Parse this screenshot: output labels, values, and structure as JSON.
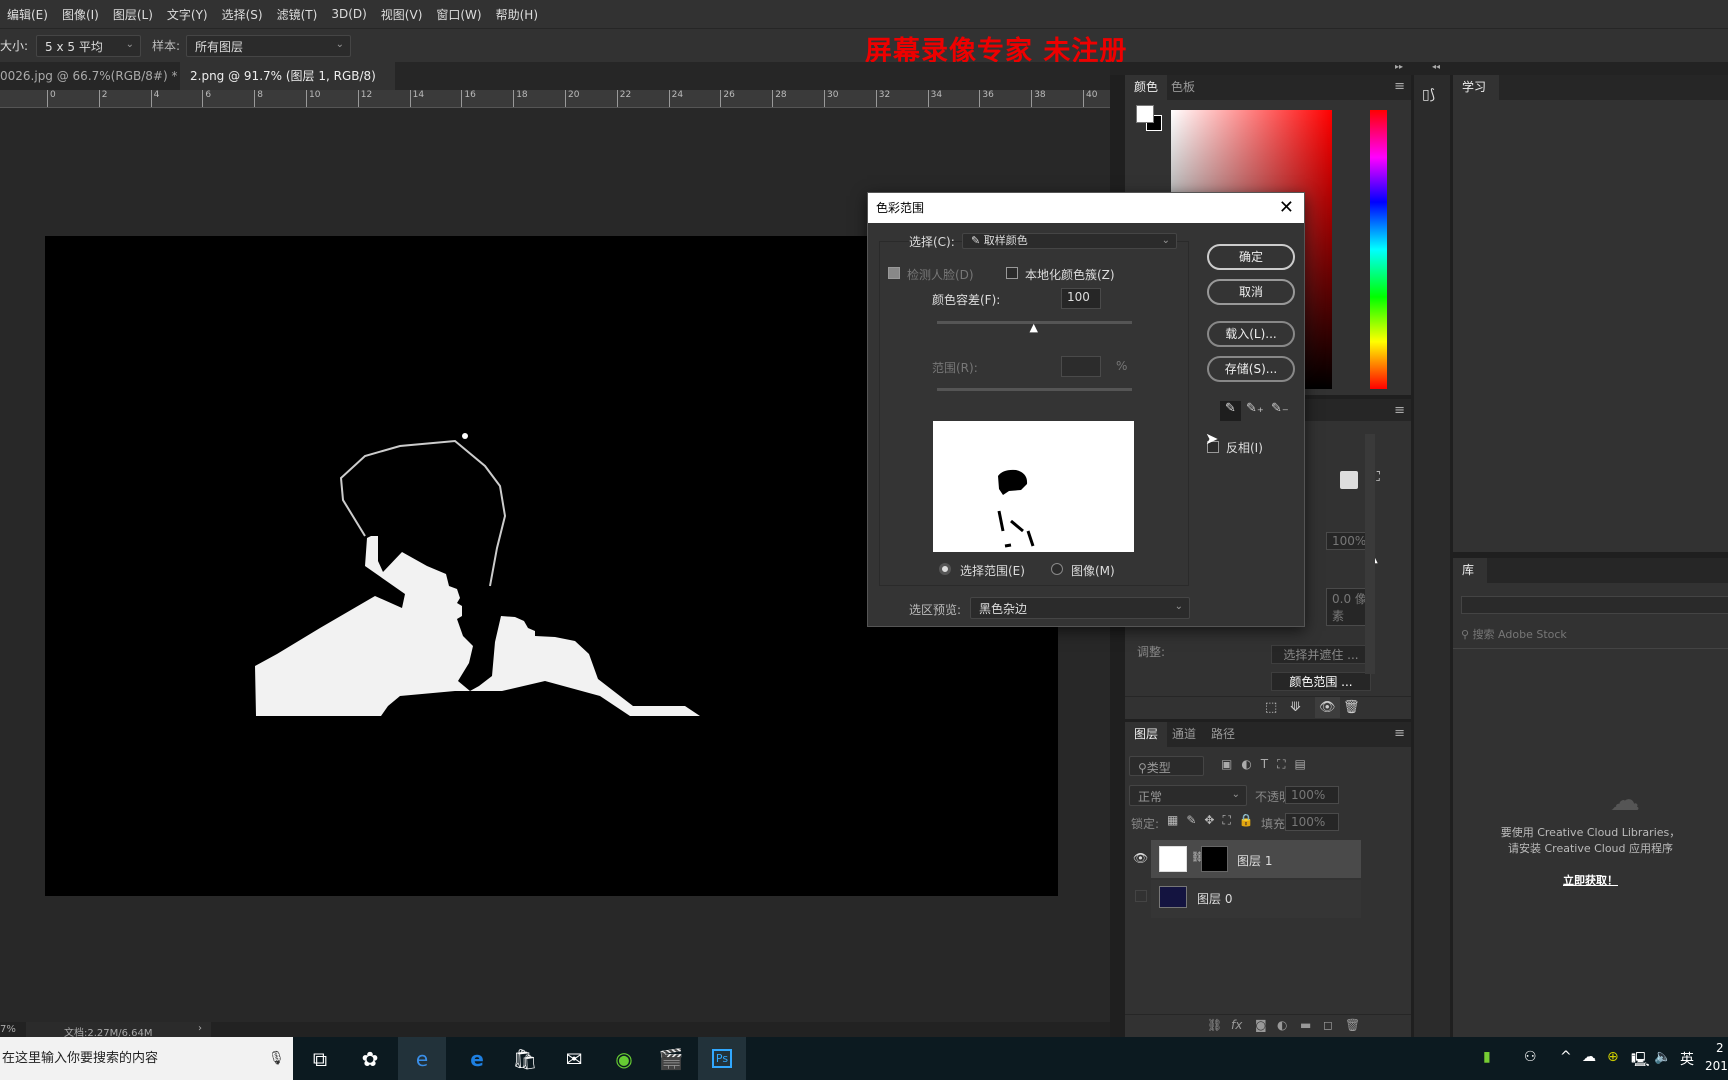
{
  "menu": [
    "编辑(E)",
    "图像(I)",
    "图层(L)",
    "文字(Y)",
    "选择(S)",
    "滤镜(T)",
    "3D(D)",
    "视图(V)",
    "窗口(W)",
    "帮助(H)"
  ],
  "options": {
    "size_label": "大小:",
    "size_value": "5 x 5 平均",
    "sample_label": "样本:",
    "sample_value": "所有图层"
  },
  "watermark": "屏幕录像专家  未注册",
  "doc_tabs": [
    {
      "label": "0026.jpg @ 66.7%(RGB/8#) *",
      "active": false
    },
    {
      "label": "2.png @ 91.7% (图层 1, RGB/8) *",
      "active": true
    }
  ],
  "close_glyph": "×",
  "ruler": [
    "0",
    "2",
    "4",
    "6",
    "8",
    "10",
    "12",
    "14",
    "16",
    "18",
    "20",
    "22",
    "24",
    "26",
    "28",
    "30",
    "32",
    "34",
    "36",
    "38",
    "40"
  ],
  "status": {
    "zoom": "7%",
    "doc": "文档:2.27M/6.64M",
    "arrow": "›"
  },
  "color_panel": {
    "tabs": [
      "颜色",
      "色板"
    ],
    "fg": "#ffffff",
    "bg": "#000000",
    "hue": "#ff0000"
  },
  "learn_panel": {
    "tab": "学习"
  },
  "library_panel": {
    "tab": "库",
    "search_placeholder": "搜索 Adobe Stock",
    "message_line1": "要使用 Creative Cloud Libraries，",
    "message_line2": "请安装 Creative Cloud 应用程序",
    "link": "立即获取！"
  },
  "properties": {
    "density": "100%",
    "feather": "0.0 像素",
    "adjust_label": "调整:",
    "select_mask_btn": "选择并遮住 ...",
    "color_range_btn": "颜色范围 ..."
  },
  "layers_panel": {
    "tabs": [
      "图层",
      "通道",
      "路径"
    ],
    "filter": "类型",
    "blend": "正常",
    "opacity_label": "不透明度:",
    "opacity": "100%",
    "lock_label": "锁定:",
    "fill_label": "填充:",
    "fill": "100%",
    "layers": [
      {
        "name": "图层 1",
        "visible": true,
        "selected": true
      },
      {
        "name": "图层 0",
        "visible": false,
        "selected": false
      }
    ]
  },
  "dialog": {
    "title": "色彩范围",
    "select_label": "选择(C):",
    "select_value": "取样颜色",
    "detect_faces": "检测人脸(D)",
    "localized": "本地化颜色簇(Z)",
    "fuzziness_label": "颜色容差(F):",
    "fuzziness": "100",
    "fuzziness_fraction": 0.5,
    "range_label": "范围(R):",
    "range_unit": "%",
    "radio_selection": "选择范围(E)",
    "radio_image": "图像(M)",
    "preview_label": "选区预览:",
    "preview_value": "黑色杂边",
    "ok": "确定",
    "cancel": "取消",
    "load": "载入(L)...",
    "save": "存储(S)...",
    "invert": "反相(I)"
  },
  "taskbar": {
    "search_placeholder": "在这里输入你要搜索的内容",
    "ime": "英",
    "clock_time": "2",
    "clock_date": "201"
  }
}
